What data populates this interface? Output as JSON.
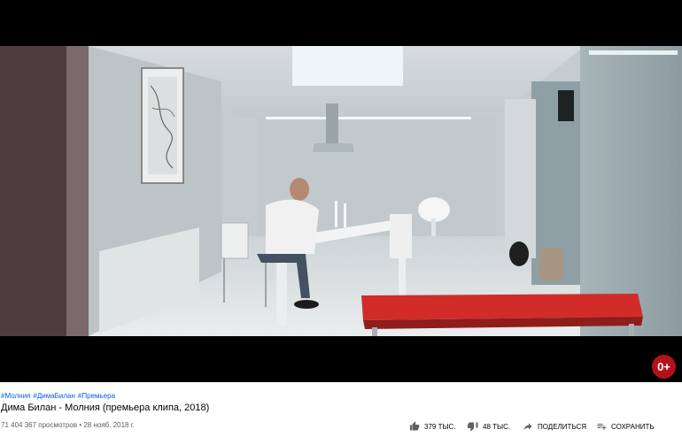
{
  "video": {
    "rating_badge": "0+"
  },
  "hashtags": [
    "#Молния",
    "#ДимаБилан",
    "#Премьера"
  ],
  "title": "Дима Билан - Молния (премьера клипа, 2018)",
  "meta": {
    "views": "71 404 367 просмотров",
    "separator": "•",
    "date": "28 нояб. 2018 г."
  },
  "actions": {
    "like_count": "379 тыс.",
    "dislike_count": "48 тыс.",
    "share_label": "Поделиться",
    "save_label": "Сохранить"
  },
  "icons": {
    "like": "thumbs-up-icon",
    "dislike": "thumbs-down-icon",
    "share": "share-icon",
    "save": "playlist-add-icon"
  }
}
